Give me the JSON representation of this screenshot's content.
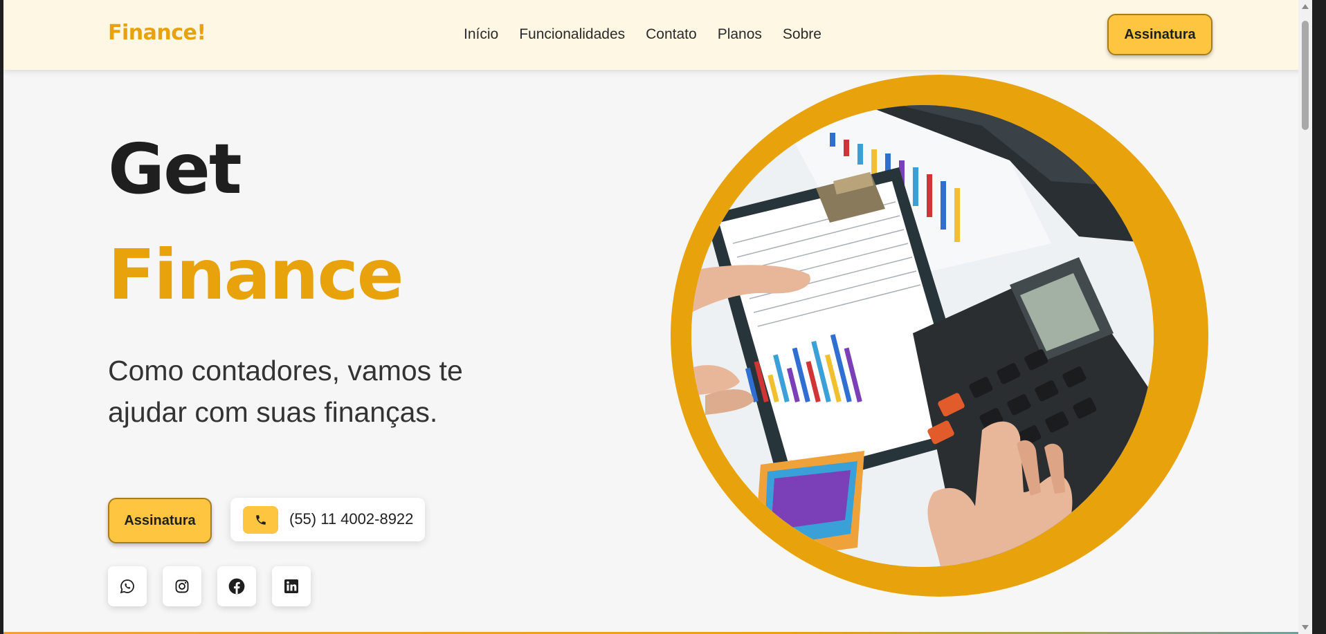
{
  "brand": {
    "logo": "Finance!",
    "accent": "#e8a20c",
    "button_color": "#fec640"
  },
  "nav": {
    "links": [
      "Início",
      "Funcionalidades",
      "Contato",
      "Planos",
      "Sobre"
    ],
    "subscribe_label": "Assinatura"
  },
  "hero": {
    "title_line1": "Get",
    "title_line2": "Finance",
    "description": "Como contadores, vamos te ajudar com suas finanças.",
    "subscribe_label": "Assinatura",
    "phone": "(55) 11 4002-8922",
    "image_icon": "finance-calculator-photo"
  },
  "socials": [
    {
      "icon": "whatsapp-icon"
    },
    {
      "icon": "instagram-icon"
    },
    {
      "icon": "facebook-icon"
    },
    {
      "icon": "linkedin-icon"
    }
  ]
}
